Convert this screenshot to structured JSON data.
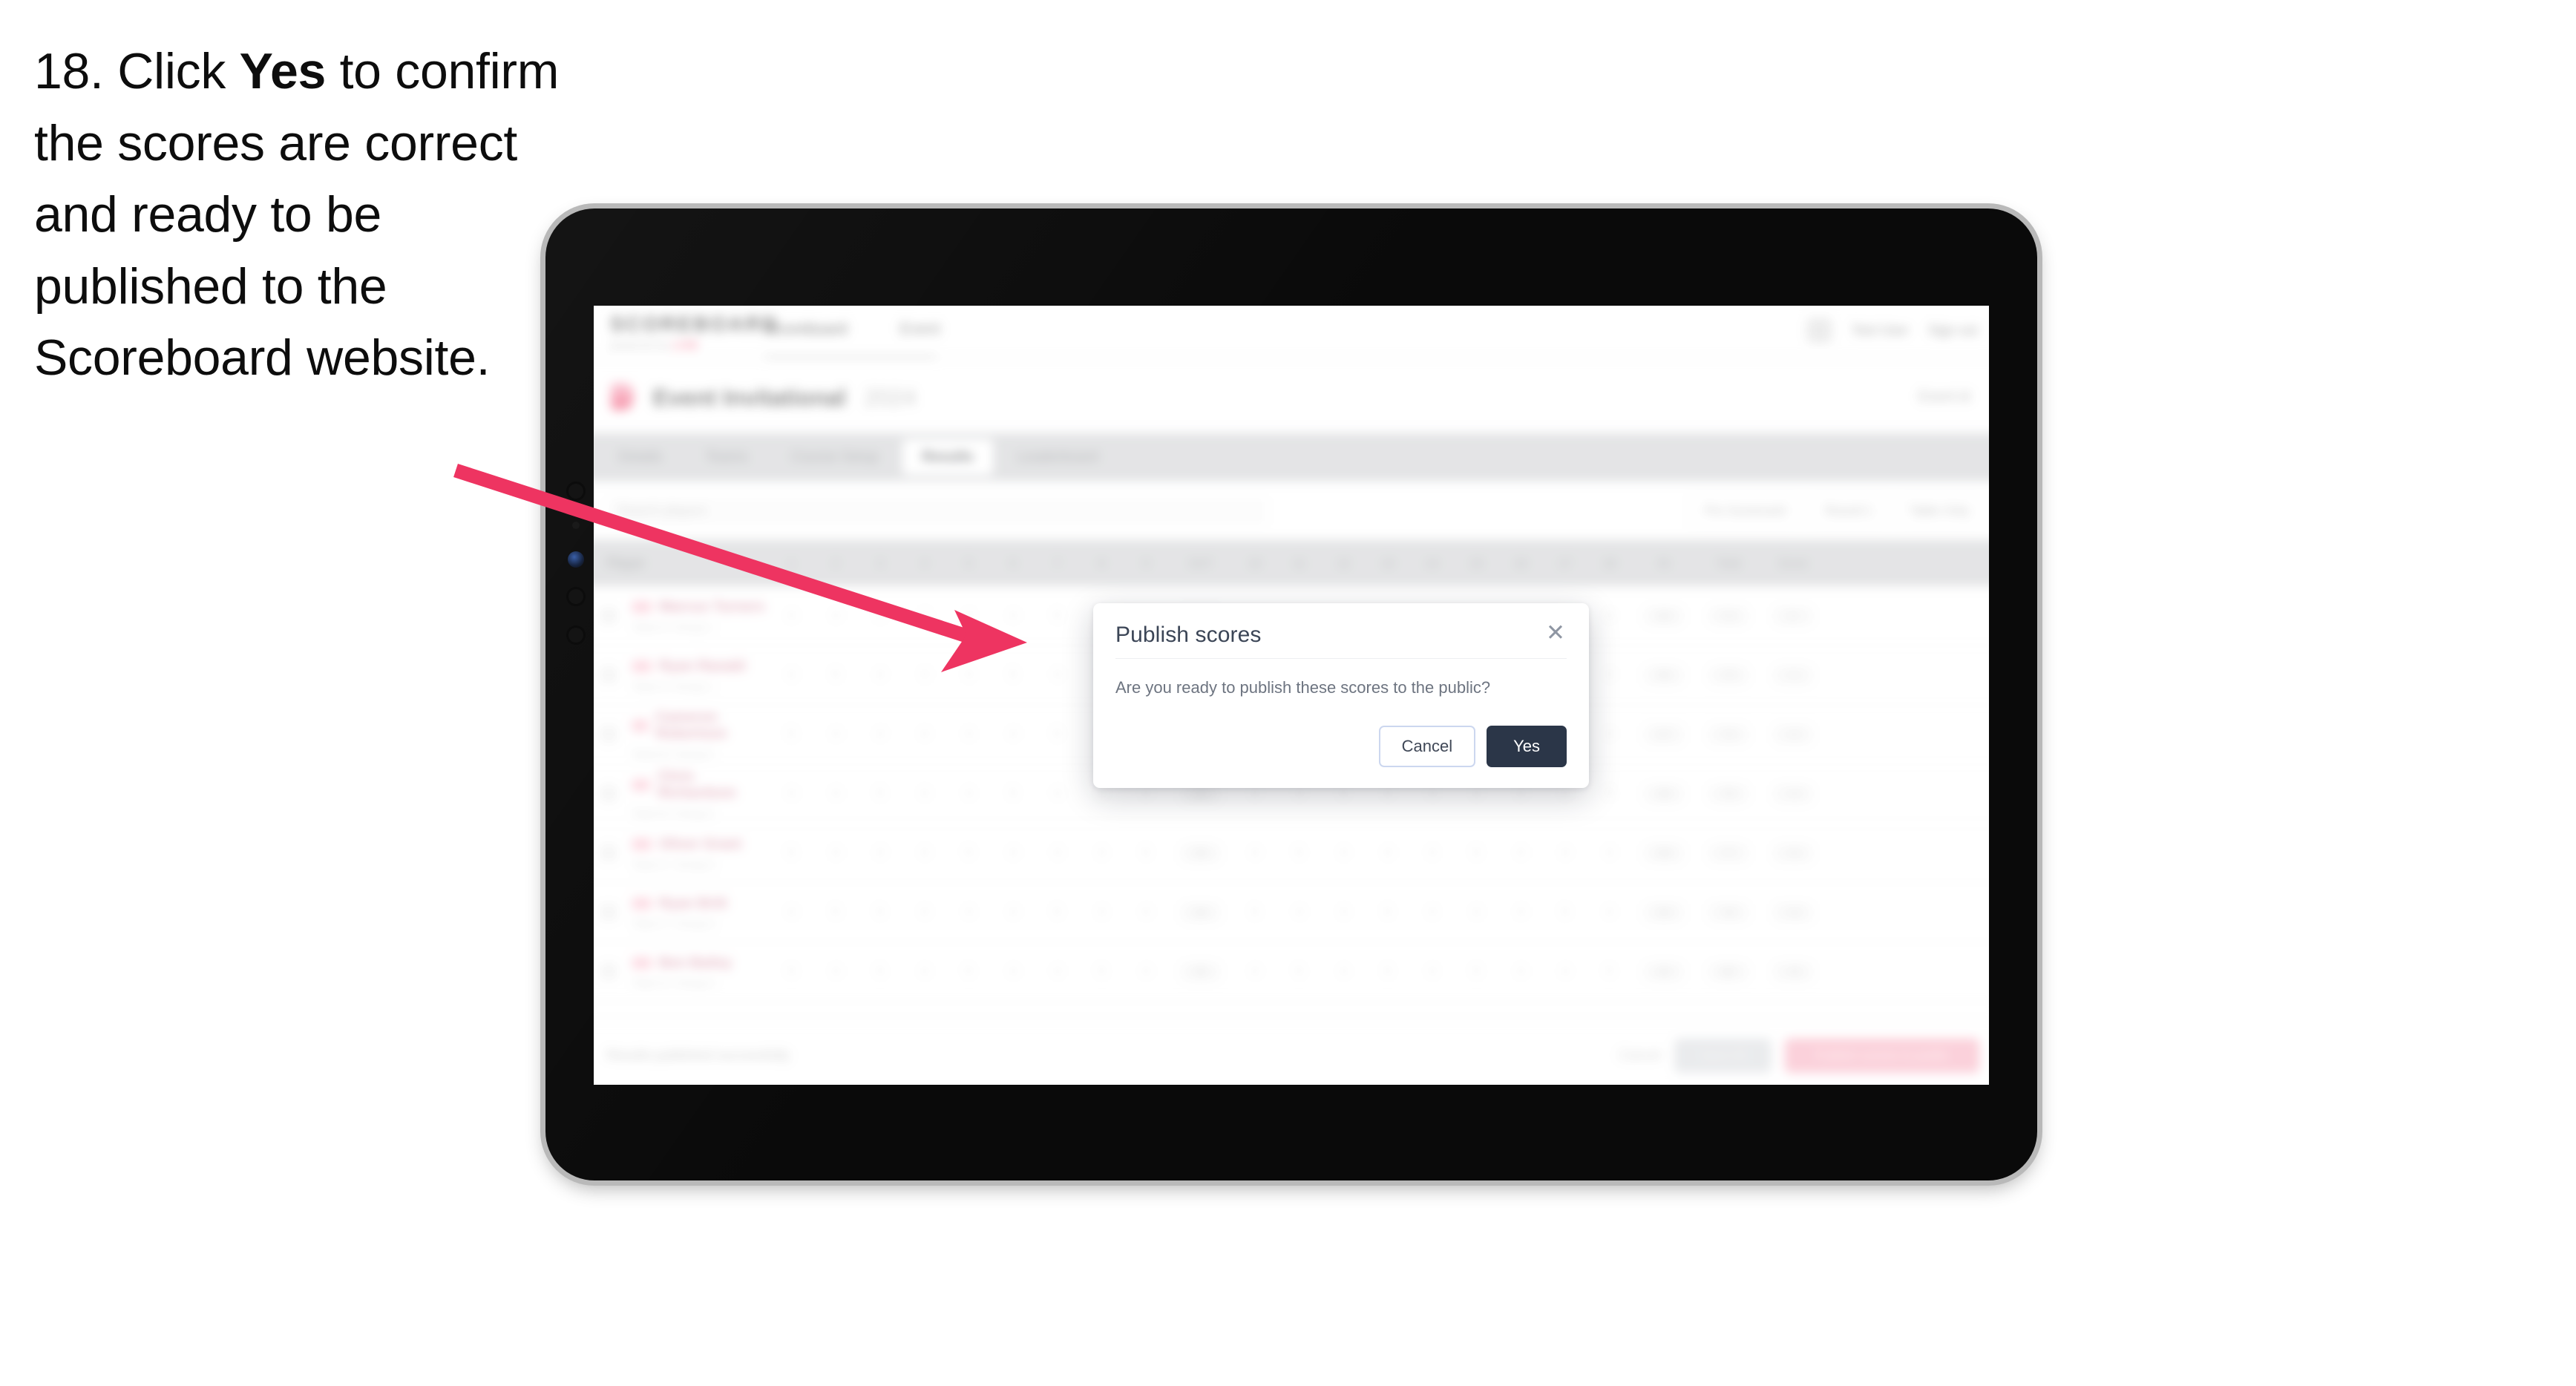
{
  "caption": {
    "number": "18.",
    "text_before": "Click",
    "emphasis": "Yes",
    "text_after": "to confirm the scores are correct and ready to be published to the Scoreboard website.",
    "full": "18. Click Yes to confirm the scores are correct and ready to be published to the Scoreboard website."
  },
  "colors": {
    "arrow": "#EE3461",
    "primary_button": "#2B3648",
    "brand_accent": "#EF3C63",
    "device_body": "#0A0A0A",
    "device_bezel": "#B9B9B9"
  },
  "modal": {
    "title": "Publish scores",
    "body": "Are you ready to publish these scores to the public?",
    "close_icon": "close-icon",
    "cancel_label": "Cancel",
    "confirm_label": "Yes"
  },
  "app": {
    "brand": {
      "word": "SCOREBOARD",
      "sub": "powered by",
      "sub_accent": "LIVE"
    },
    "topnav": [
      {
        "label": "Scoreboard"
      },
      {
        "label": "Event"
      }
    ],
    "topright": {
      "avatar": "avatar",
      "user": "Test User",
      "signout": "Sign out"
    },
    "page": {
      "icon": "event-icon",
      "title": "Event Invitational",
      "subtitle": "2024",
      "headlink": "Event id"
    },
    "tabs": [
      {
        "label": "Details",
        "active": false
      },
      {
        "label": "Teams",
        "active": false
      },
      {
        "label": "Course Setup",
        "active": false
      },
      {
        "label": "Results",
        "active": true
      },
      {
        "label": "Leaderboard",
        "active": false
      }
    ],
    "search": {
      "placeholder": "Search players"
    },
    "filters": [
      {
        "label": "Pre Scorecard"
      },
      {
        "label": "Round 1"
      },
      {
        "label": "Table Only"
      },
      {
        "label": "filter-icon"
      }
    ],
    "table": {
      "columns": [
        "Player",
        "1",
        "2",
        "3",
        "4",
        "5",
        "6",
        "7",
        "8",
        "9",
        "OUT",
        "10",
        "11",
        "12",
        "13",
        "14",
        "15",
        "16",
        "17",
        "18",
        "IN",
        "Total",
        "Score"
      ],
      "rows": [
        {
          "name": "Marcus Turners",
          "tag": "AM",
          "team": "Team A / Group 1",
          "scores": [
            "4",
            "4",
            "5",
            "3",
            "4",
            "4",
            "5",
            "3",
            "4"
          ],
          "out": "36",
          "in_scores": [
            "4",
            "5",
            "3",
            "4",
            "4",
            "5",
            "4",
            "3",
            "4"
          ],
          "in": "36",
          "total": "72",
          "score": "E"
        },
        {
          "name": "Ryan Ranald",
          "tag": "AM",
          "team": "Team A / Group 1",
          "scores": [
            "4",
            "5",
            "4",
            "3",
            "4",
            "5",
            "4",
            "4",
            "4"
          ],
          "out": "37",
          "in_scores": [
            "4",
            "4",
            "4",
            "3",
            "5",
            "4",
            "4",
            "4",
            "4"
          ],
          "in": "36",
          "total": "73",
          "score": "+1"
        },
        {
          "name": "Cameron Robertson",
          "tag": "AM",
          "team": "Team B / Group 2",
          "scores": [
            "5",
            "4",
            "4",
            "4",
            "4",
            "4",
            "5",
            "3",
            "4"
          ],
          "out": "37",
          "in_scores": [
            "4",
            "5",
            "4",
            "4",
            "4",
            "4",
            "5",
            "3",
            "4"
          ],
          "in": "37",
          "total": "74",
          "score": "+2"
        },
        {
          "name": "Chris Richardson",
          "tag": "AM",
          "team": "Team B / Group 2",
          "scores": [
            "4",
            "4",
            "5",
            "4",
            "4",
            "5",
            "4",
            "4",
            "4"
          ],
          "out": "38",
          "in_scores": [
            "4",
            "4",
            "5",
            "4",
            "4",
            "4",
            "4",
            "4",
            "5"
          ],
          "in": "38",
          "total": "76",
          "score": "+4"
        },
        {
          "name": "Oliver Grant",
          "tag": "AM",
          "team": "Team C / Group 3",
          "scores": [
            "5",
            "4",
            "4",
            "4",
            "5",
            "4",
            "4",
            "4",
            "5"
          ],
          "out": "39",
          "in_scores": [
            "4",
            "5",
            "4",
            "4",
            "4",
            "5",
            "4",
            "4",
            "4"
          ],
          "in": "38",
          "total": "77",
          "score": "+5"
        },
        {
          "name": "Ryan Britt",
          "tag": "AM",
          "team": "Team C / Group 3",
          "scores": [
            "4",
            "5",
            "5",
            "4",
            "4",
            "4",
            "5",
            "4",
            "4"
          ],
          "out": "39",
          "in_scores": [
            "5",
            "4",
            "4",
            "5",
            "4",
            "4",
            "4",
            "5",
            "4"
          ],
          "in": "39",
          "total": "78",
          "score": "+6"
        },
        {
          "name": "Ben Bailey",
          "tag": "AM",
          "team": "Team D / Group 4",
          "scores": [
            "5",
            "4",
            "5",
            "4",
            "5",
            "4",
            "4",
            "5",
            "4"
          ],
          "out": "40",
          "in_scores": [
            "4",
            "5",
            "4",
            "5",
            "4",
            "5",
            "4",
            "4",
            "5"
          ],
          "in": "40",
          "total": "80",
          "score": "+8"
        }
      ]
    },
    "footer": {
      "note": "Results published successfully",
      "ghost": "Cancel",
      "secondary": "Save All",
      "primary": "Publish scores to public"
    }
  }
}
